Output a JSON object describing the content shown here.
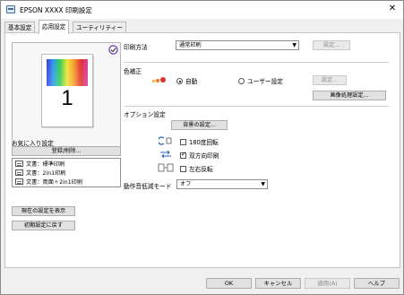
{
  "window": {
    "title": "EPSON XXXX 印刷設定",
    "close_glyph": "✕"
  },
  "tabs": [
    {
      "label": "基本設定"
    },
    {
      "label": "応用設定",
      "active": true
    },
    {
      "label": "ユーティリティー"
    }
  ],
  "preview": {
    "page_number": "1"
  },
  "favorites": {
    "heading": "お気に入り設定",
    "register_button": "登録/削除...",
    "items": [
      {
        "label": "文書：標準印刷"
      },
      {
        "label": "文書：2in1印刷"
      },
      {
        "label": "文書：両面＋2in1印刷"
      }
    ]
  },
  "left_buttons": {
    "show_current": "現在の設定を表示",
    "reset": "初期設定に戻す"
  },
  "print_method": {
    "label": "印刷方法",
    "value": "通常印刷",
    "settings_button": "設定..."
  },
  "color_correction": {
    "label": "色補正",
    "auto_label": "自動",
    "user_label": "ユーザー設定",
    "settings_button": "設定...",
    "image_button": "画像処理設定...",
    "colors": {
      "dot1": "#e4302d",
      "dot2": "#f07a1a",
      "dot3": "#f0b31a"
    }
  },
  "options": {
    "label": "オプション設定",
    "background_button": "背景の設定...",
    "rotate180": "180度回転",
    "bidirectional": "双方向印刷",
    "mirror": "左右反転",
    "quiet_mode_label": "動作音低減モード",
    "quiet_mode_value": "オフ"
  },
  "footer": {
    "ok": "OK",
    "cancel": "キャンセル",
    "apply": "適用(A)",
    "help": "ヘルプ"
  }
}
